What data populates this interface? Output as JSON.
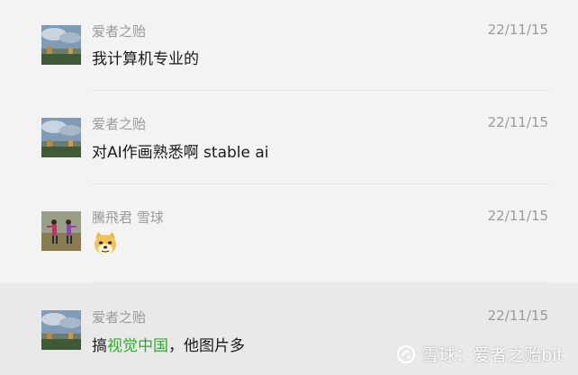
{
  "messages": [
    {
      "sender": "爱者之贻",
      "time": "22/11/15",
      "text": "我计算机专业的",
      "avatar": "landscape-avatar"
    },
    {
      "sender": "爱者之贻",
      "time": "22/11/15",
      "text": "对AI作画熟悉啊  stable ai",
      "avatar": "landscape-avatar"
    },
    {
      "sender": "騰飛君 雪球",
      "time": "22/11/15",
      "emoji": "doge-emoji",
      "avatar": "dancers-avatar"
    },
    {
      "sender": "爱者之贻",
      "time": "22/11/15",
      "text_prefix": "搞",
      "link_text": "视觉中国",
      "text_suffix": "，他图片多",
      "avatar": "landscape-avatar"
    }
  ],
  "watermark": {
    "text": "雪球：爱者之贻bit",
    "icon": "xueqiu-logo-icon"
  },
  "colors": {
    "background": "#f3f3f3",
    "highlight_background": "#e9e9e9",
    "meta_text": "#9a9a9a",
    "link": "#2aae2a"
  }
}
